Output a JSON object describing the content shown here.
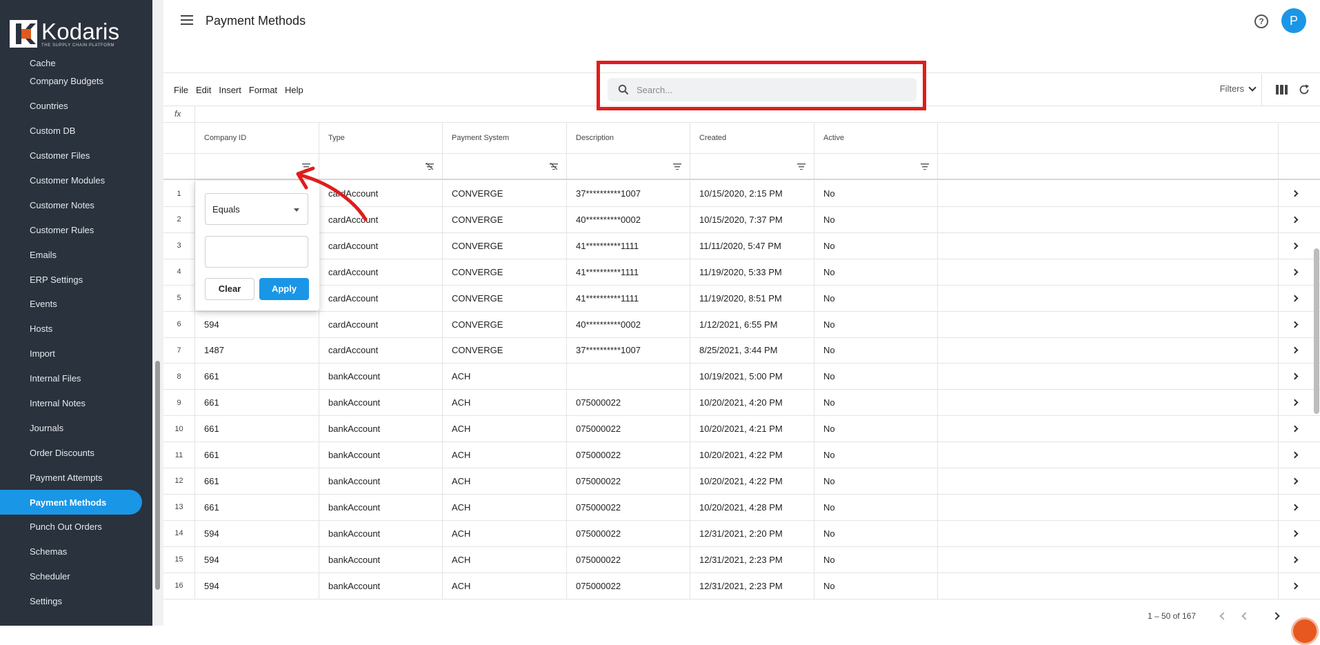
{
  "brand": {
    "name": "Kodaris",
    "tagline": "THE SUPPLY CHAIN PLATFORM",
    "accent": "#1a96e6",
    "logo_color": "#e05a1e"
  },
  "header": {
    "title": "Payment Methods",
    "avatar_initial": "P"
  },
  "sidebar": {
    "items": [
      {
        "label": "Cache"
      },
      {
        "label": "Company Budgets"
      },
      {
        "label": "Countries"
      },
      {
        "label": "Custom DB"
      },
      {
        "label": "Customer Files"
      },
      {
        "label": "Customer Modules"
      },
      {
        "label": "Customer Notes"
      },
      {
        "label": "Customer Rules"
      },
      {
        "label": "Emails"
      },
      {
        "label": "ERP Settings"
      },
      {
        "label": "Events"
      },
      {
        "label": "Hosts"
      },
      {
        "label": "Import"
      },
      {
        "label": "Internal Files"
      },
      {
        "label": "Internal Notes"
      },
      {
        "label": "Journals"
      },
      {
        "label": "Order Discounts"
      },
      {
        "label": "Payment Attempts"
      },
      {
        "label": "Payment Methods"
      },
      {
        "label": "Punch Out Orders"
      },
      {
        "label": "Schemas"
      },
      {
        "label": "Scheduler"
      },
      {
        "label": "Settings"
      }
    ]
  },
  "toolbar": {
    "menus": [
      "File",
      "Edit",
      "Insert",
      "Format",
      "Help"
    ],
    "search_placeholder": "Search...",
    "filters_label": "Filters",
    "fx_label": "fx"
  },
  "grid": {
    "columns": [
      "Company ID",
      "Type",
      "Payment System",
      "Description",
      "Created",
      "Active"
    ],
    "rows": [
      {
        "num": "1",
        "company": "",
        "type": "cardAccount",
        "system": "CONVERGE",
        "desc": "37**********1007",
        "created": "10/15/2020, 2:15 PM",
        "active": "No"
      },
      {
        "num": "2",
        "company": "",
        "type": "cardAccount",
        "system": "CONVERGE",
        "desc": "40**********0002",
        "created": "10/15/2020, 7:37 PM",
        "active": "No"
      },
      {
        "num": "3",
        "company": "",
        "type": "cardAccount",
        "system": "CONVERGE",
        "desc": "41**********1111",
        "created": "11/11/2020, 5:47 PM",
        "active": "No"
      },
      {
        "num": "4",
        "company": "",
        "type": "cardAccount",
        "system": "CONVERGE",
        "desc": "41**********1111",
        "created": "11/19/2020, 5:33 PM",
        "active": "No"
      },
      {
        "num": "5",
        "company": "",
        "type": "cardAccount",
        "system": "CONVERGE",
        "desc": "41**********1111",
        "created": "11/19/2020, 8:51 PM",
        "active": "No"
      },
      {
        "num": "6",
        "company": "594",
        "type": "cardAccount",
        "system": "CONVERGE",
        "desc": "40**********0002",
        "created": "1/12/2021, 6:55 PM",
        "active": "No"
      },
      {
        "num": "7",
        "company": "1487",
        "type": "cardAccount",
        "system": "CONVERGE",
        "desc": "37**********1007",
        "created": "8/25/2021, 3:44 PM",
        "active": "No"
      },
      {
        "num": "8",
        "company": "661",
        "type": "bankAccount",
        "system": "ACH",
        "desc": "",
        "created": "10/19/2021, 5:00 PM",
        "active": "No"
      },
      {
        "num": "9",
        "company": "661",
        "type": "bankAccount",
        "system": "ACH",
        "desc": "075000022",
        "created": "10/20/2021, 4:20 PM",
        "active": "No"
      },
      {
        "num": "10",
        "company": "661",
        "type": "bankAccount",
        "system": "ACH",
        "desc": "075000022",
        "created": "10/20/2021, 4:21 PM",
        "active": "No"
      },
      {
        "num": "11",
        "company": "661",
        "type": "bankAccount",
        "system": "ACH",
        "desc": "075000022",
        "created": "10/20/2021, 4:22 PM",
        "active": "No"
      },
      {
        "num": "12",
        "company": "661",
        "type": "bankAccount",
        "system": "ACH",
        "desc": "075000022",
        "created": "10/20/2021, 4:22 PM",
        "active": "No"
      },
      {
        "num": "13",
        "company": "661",
        "type": "bankAccount",
        "system": "ACH",
        "desc": "075000022",
        "created": "10/20/2021, 4:28 PM",
        "active": "No"
      },
      {
        "num": "14",
        "company": "594",
        "type": "bankAccount",
        "system": "ACH",
        "desc": "075000022",
        "created": "12/31/2021, 2:20 PM",
        "active": "No"
      },
      {
        "num": "15",
        "company": "594",
        "type": "bankAccount",
        "system": "ACH",
        "desc": "075000022",
        "created": "12/31/2021, 2:23 PM",
        "active": "No"
      },
      {
        "num": "16",
        "company": "594",
        "type": "bankAccount",
        "system": "ACH",
        "desc": "075000022",
        "created": "12/31/2021, 2:23 PM",
        "active": "No"
      }
    ]
  },
  "filter_popup": {
    "operator": "Equals",
    "value": "",
    "clear_label": "Clear",
    "apply_label": "Apply"
  },
  "footer": {
    "pagination_text": "1 – 50 of 167"
  },
  "annotations": {
    "highlight_color": "#e11c1c"
  }
}
